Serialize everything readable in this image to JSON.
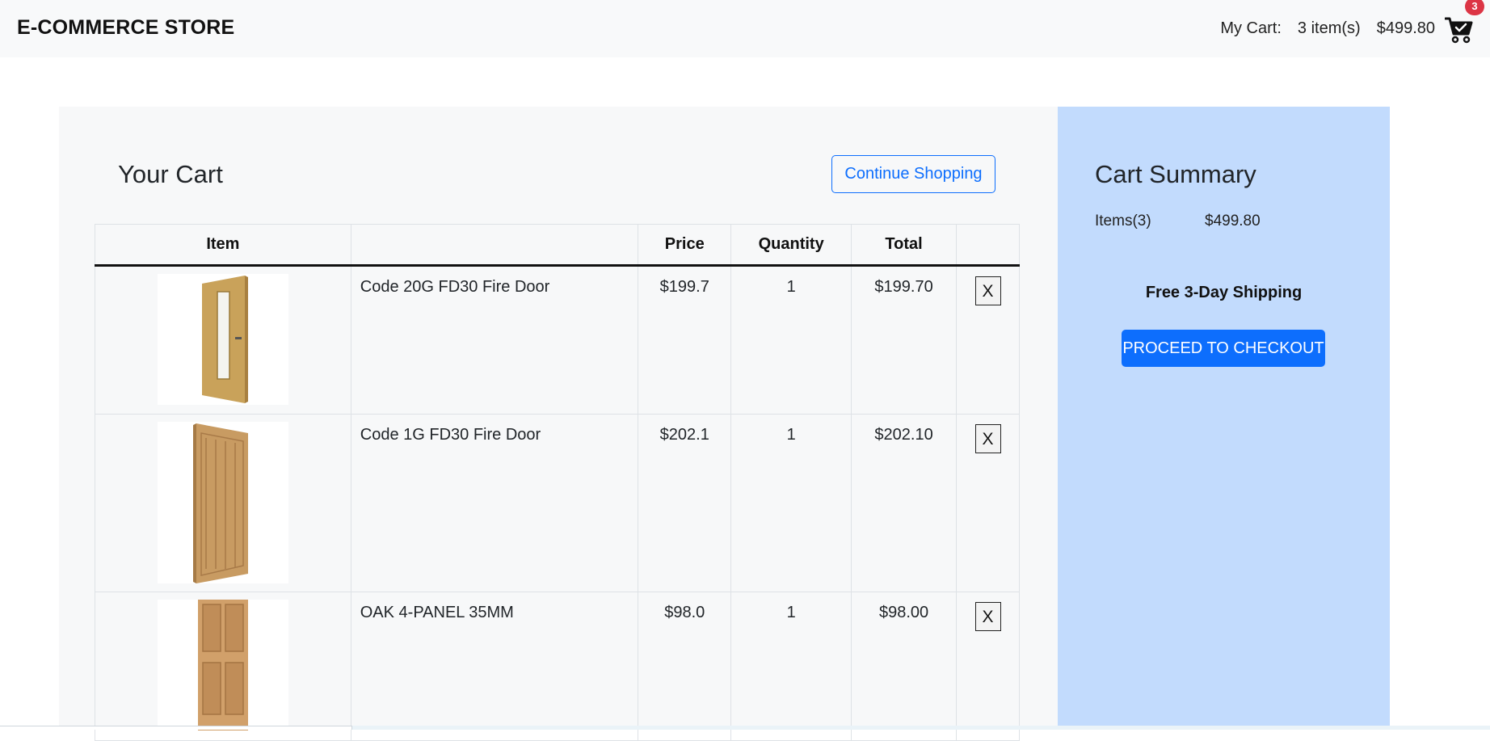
{
  "header": {
    "brand": "E-COMMERCE STORE",
    "cart_label": "My Cart:",
    "cart_count": "3 item(s)",
    "cart_total": "$499.80",
    "badge_count": "3"
  },
  "cart": {
    "title": "Your Cart",
    "continue_label": "Continue Shopping",
    "columns": [
      "Item",
      "",
      "Price",
      "Quantity",
      "Total",
      ""
    ],
    "rows": [
      {
        "name": "Code 20G FD30 Fire Door",
        "price": "$199.7",
        "qty": "1",
        "total": "$199.70",
        "remove": "X",
        "image": "glazed-fire-door"
      },
      {
        "name": "Code 1G FD30 Fire Door",
        "price": "$202.1",
        "qty": "1",
        "total": "$202.10",
        "remove": "X",
        "image": "oak-grooved-door"
      },
      {
        "name": "OAK 4-PANEL 35MM",
        "price": "$98.0",
        "qty": "1",
        "total": "$98.00",
        "remove": "X",
        "image": "oak-four-panel-door"
      }
    ]
  },
  "summary": {
    "title": "Cart Summary",
    "items_label": "Items(3)",
    "items_total": "$499.80",
    "shipping": "Free 3-Day Shipping",
    "checkout_label": "PROCEED TO CHECKOUT"
  },
  "colors": {
    "accent": "#0d6efd",
    "summary_bg": "#c2dbfd",
    "badge": "#dc3545",
    "panel_bg": "#f7f8f9"
  }
}
